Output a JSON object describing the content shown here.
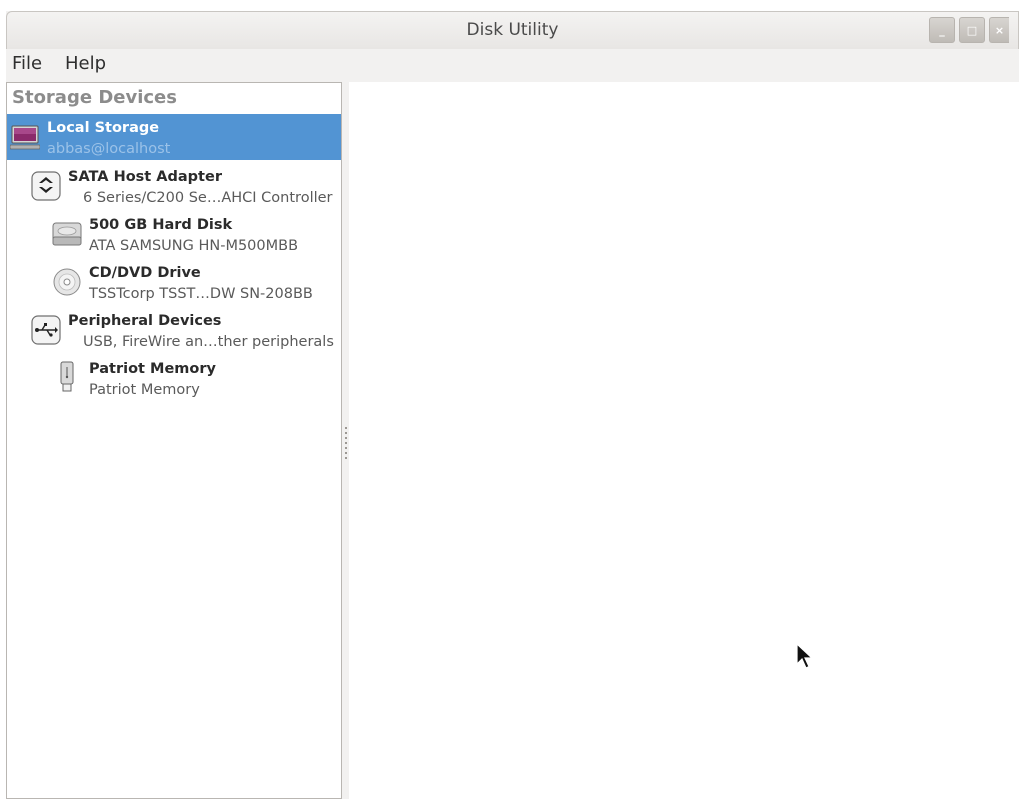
{
  "window": {
    "title": "Disk Utility",
    "controls": {
      "close": "×",
      "minimize": "_",
      "maximize": "□"
    }
  },
  "menu": {
    "items": [
      "File",
      "Help"
    ]
  },
  "sidebar": {
    "heading": "Storage Devices",
    "items": [
      {
        "title": "Local Storage",
        "subtitle": "abbas@localhost",
        "icon": "computer-icon",
        "selected": true
      },
      {
        "title": "SATA Host Adapter",
        "subtitle": "6 Series/C200 Se…AHCI Controller",
        "icon": "sata-adapter-icon",
        "selected": false
      },
      {
        "title": "500 GB Hard Disk",
        "subtitle": "ATA SAMSUNG HN-M500MBB",
        "icon": "hard-disk-icon",
        "selected": false
      },
      {
        "title": "CD/DVD Drive",
        "subtitle": "TSSTcorp TSST…DW SN-208BB",
        "icon": "optical-disc-icon",
        "selected": false
      },
      {
        "title": "Peripheral Devices",
        "subtitle": "USB, FireWire an…ther peripherals",
        "icon": "usb-icon",
        "selected": false
      },
      {
        "title": "Patriot Memory",
        "subtitle": "Patriot Memory",
        "icon": "usb-stick-icon",
        "selected": false
      }
    ]
  },
  "colors": {
    "selection": "#5294d3",
    "window_bg": "#f2f1f0"
  }
}
